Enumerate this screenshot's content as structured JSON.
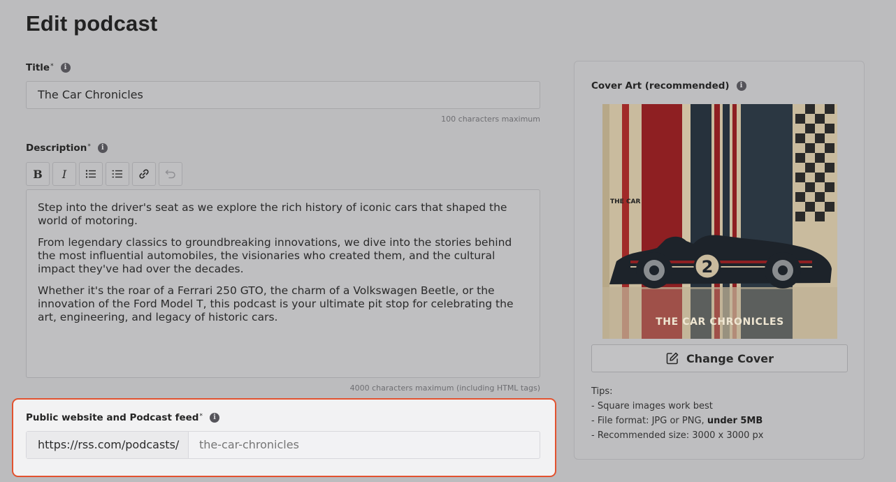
{
  "page": {
    "title": "Edit podcast"
  },
  "title_field": {
    "label": "Title",
    "required_mark": "*",
    "value": "The Car Chronicles",
    "hint": "100 characters maximum"
  },
  "description_field": {
    "label": "Description",
    "required_mark": "*",
    "toolbar": {
      "bold_label": "B",
      "italic_label": "I"
    },
    "paragraphs": [
      "Step into the driver's seat as we explore the rich history of iconic cars that shaped the world of motoring.",
      "From legendary classics to groundbreaking innovations, we dive into the stories behind the most influential automobiles, the visionaries who created them, and the cultural impact they've had over the decades.",
      "Whether it's the roar of a Ferrari 250 GTO, the charm of a Volkswagen Beetle, or the innovation of the Ford Model T, this podcast is your ultimate pit stop for celebrating the art, engineering, and legacy of historic cars."
    ],
    "hint": "4000 characters maximum (including HTML tags)"
  },
  "feed_field": {
    "label": "Public website and Podcast feed",
    "required_mark": "*",
    "prefix": "https://rss.com/podcasts/",
    "slug_placeholder": "the-car-chronicles"
  },
  "cover": {
    "label": "Cover Art (recommended)",
    "art_text_small": "THE CAR",
    "art_text_title": "THE CAR CHRONICLES",
    "art_number": "2",
    "change_button": "Change Cover",
    "tips": {
      "heading": "Tips:",
      "line1": "- Square images work best",
      "line2_prefix": "- File format: JPG or PNG, ",
      "line2_bold": "under 5MB",
      "line3": "- Recommended size: 3000 x 3000 px"
    }
  },
  "icon_glyphs": {
    "info": "i"
  }
}
